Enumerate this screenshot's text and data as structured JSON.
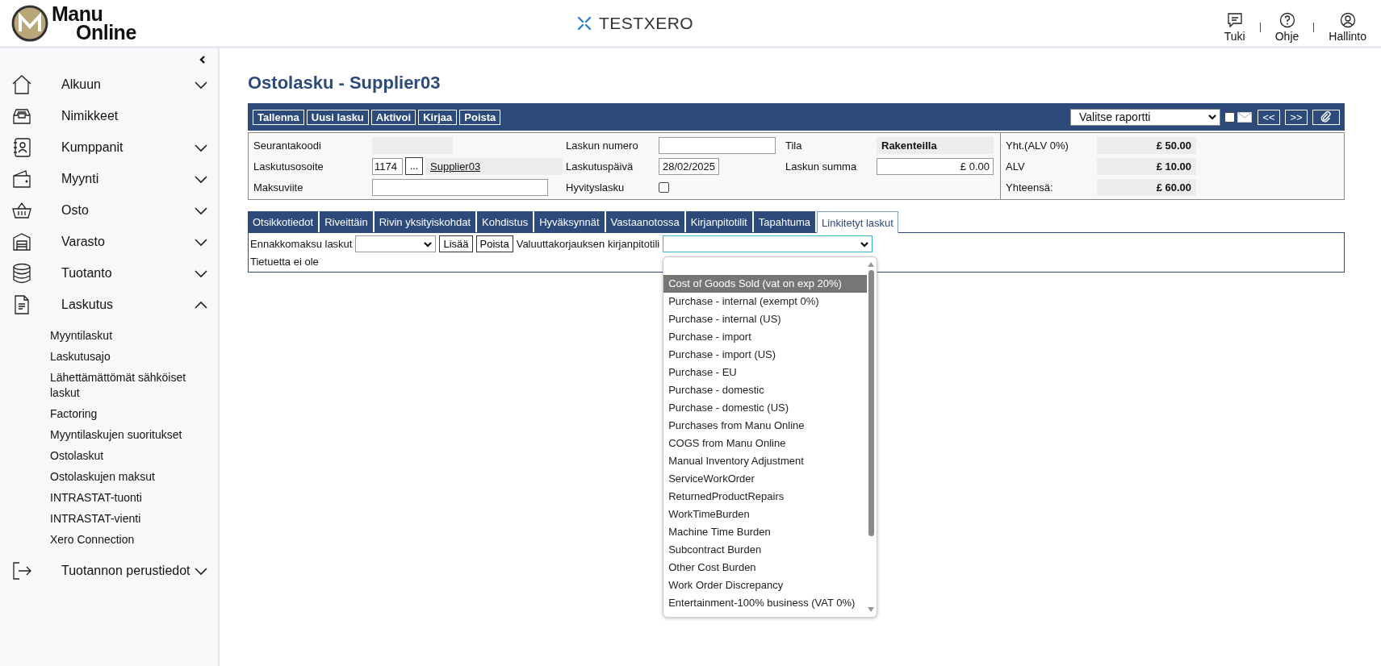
{
  "header": {
    "logo": {
      "line1": "Manu",
      "line2": "Online"
    },
    "company": "TESTXERO",
    "actions": [
      {
        "label": "Tuki",
        "kind": "chat"
      },
      {
        "label": "Ohje",
        "kind": "help"
      },
      {
        "label": "Hallinto",
        "kind": "user"
      }
    ]
  },
  "sidebar": {
    "items": [
      {
        "label": "Alkuun",
        "kind": "home",
        "expandable": true,
        "expanded": false
      },
      {
        "label": "Nimikkeet",
        "kind": "tray",
        "expandable": false
      },
      {
        "label": "Kumppanit",
        "kind": "contacts",
        "expandable": true,
        "expanded": false
      },
      {
        "label": "Myynti",
        "kind": "wallet",
        "expandable": true,
        "expanded": false
      },
      {
        "label": "Osto",
        "kind": "basket",
        "expandable": true,
        "expanded": false
      },
      {
        "label": "Varasto",
        "kind": "warehouse",
        "expandable": true,
        "expanded": false
      },
      {
        "label": "Tuotanto",
        "kind": "database",
        "expandable": true,
        "expanded": false
      },
      {
        "label": "Laskutus",
        "kind": "document",
        "expandable": true,
        "expanded": true,
        "children": [
          {
            "label": "Myyntilaskut"
          },
          {
            "label": "Laskutusajo"
          },
          {
            "label": "Lähettämättömät sähköiset laskut"
          },
          {
            "label": "Factoring"
          },
          {
            "label": "Myyntilaskujen suoritukset"
          },
          {
            "label": "Ostolaskut"
          },
          {
            "label": "Ostolaskujen maksut"
          },
          {
            "label": "INTRASTAT-tuonti"
          },
          {
            "label": "INTRASTAT-vienti"
          },
          {
            "label": "Xero Connection"
          }
        ]
      },
      {
        "label": "Tuotannon perustiedot",
        "kind": "exit",
        "expandable": true,
        "expanded": false
      }
    ]
  },
  "page_title": "Ostolasku - Supplier03",
  "toolbar": {
    "buttons": [
      "Tallenna",
      "Uusi lasku",
      "Aktivoi",
      "Kirjaa",
      "Poista"
    ],
    "report_select": "Valitse raportti",
    "email_checked": false,
    "nav_buttons": [
      "<<",
      ">>"
    ]
  },
  "form": {
    "tracking_code": {
      "label": "Seurantakoodi"
    },
    "billing_address": {
      "label": "Laskutusosoite",
      "code": "1174",
      "picker": "...",
      "supplier": "Supplier03"
    },
    "payment_ref": {
      "label": "Maksuviite"
    },
    "invoice_number": {
      "label": "Laskun numero"
    },
    "invoice_date": {
      "label": "Laskutuspäivä",
      "value": "28/02/2025"
    },
    "credit_note": {
      "label": "Hyvityslasku",
      "checked": false
    },
    "status": {
      "label": "Tila",
      "value": "Rakenteilla"
    },
    "invoice_sum": {
      "label": "Laskun summa",
      "value": "£ 0.00"
    },
    "totals": [
      {
        "label": "Yht.(ALV 0%)",
        "value": "£ 50.00"
      },
      {
        "label": "ALV",
        "value": "£ 10.00"
      },
      {
        "label": "Yhteensä:",
        "value": "£ 60.00"
      }
    ]
  },
  "tabs": [
    {
      "label": "Otsikkotiedot",
      "selected": false
    },
    {
      "label": "Riveittäin",
      "selected": false
    },
    {
      "label": "Rivin yksityiskohdat",
      "selected": false
    },
    {
      "label": "Kohdistus",
      "selected": false
    },
    {
      "label": "Hyväksynnät",
      "selected": false
    },
    {
      "label": "Vastaanotossa",
      "selected": false
    },
    {
      "label": "Kirjanpitotilit",
      "selected": false
    },
    {
      "label": "Tapahtuma",
      "selected": false
    },
    {
      "label": "Linkitetyt laskut",
      "selected": true
    }
  ],
  "linked": {
    "prepayment_label": "Ennakkomaksu laskut",
    "add_button": "Lisää",
    "remove_button": "Poista",
    "account_label": "Valuuttakorjauksen kirjanpitotili",
    "empty_text": "Tietuetta ei ole",
    "account_options": [
      {
        "label": "Cost of Goods Sold (vat on exp 20%)",
        "selected": true
      },
      {
        "label": "Purchase - internal (exempt 0%)",
        "selected": false
      },
      {
        "label": "Purchase - internal (US)",
        "selected": false
      },
      {
        "label": "Purchase - import",
        "selected": false
      },
      {
        "label": "Purchase - import (US)",
        "selected": false
      },
      {
        "label": "Purchase - EU",
        "selected": false
      },
      {
        "label": "Purchase - domestic",
        "selected": false
      },
      {
        "label": "Purchase - domestic (US)",
        "selected": false
      },
      {
        "label": "Purchases from Manu Online",
        "selected": false
      },
      {
        "label": "COGS from Manu Online",
        "selected": false
      },
      {
        "label": "Manual Inventory Adjustment",
        "selected": false
      },
      {
        "label": "ServiceWorkOrder",
        "selected": false
      },
      {
        "label": "ReturnedProductRepairs",
        "selected": false
      },
      {
        "label": "WorkTimeBurden",
        "selected": false
      },
      {
        "label": "Machine Time Burden",
        "selected": false
      },
      {
        "label": "Subcontract Burden",
        "selected": false
      },
      {
        "label": "Other Cost Burden",
        "selected": false
      },
      {
        "label": "Work Order Discrepancy",
        "selected": false
      },
      {
        "label": "Entertainment-100% business (VAT 0%)",
        "selected": false
      }
    ]
  }
}
